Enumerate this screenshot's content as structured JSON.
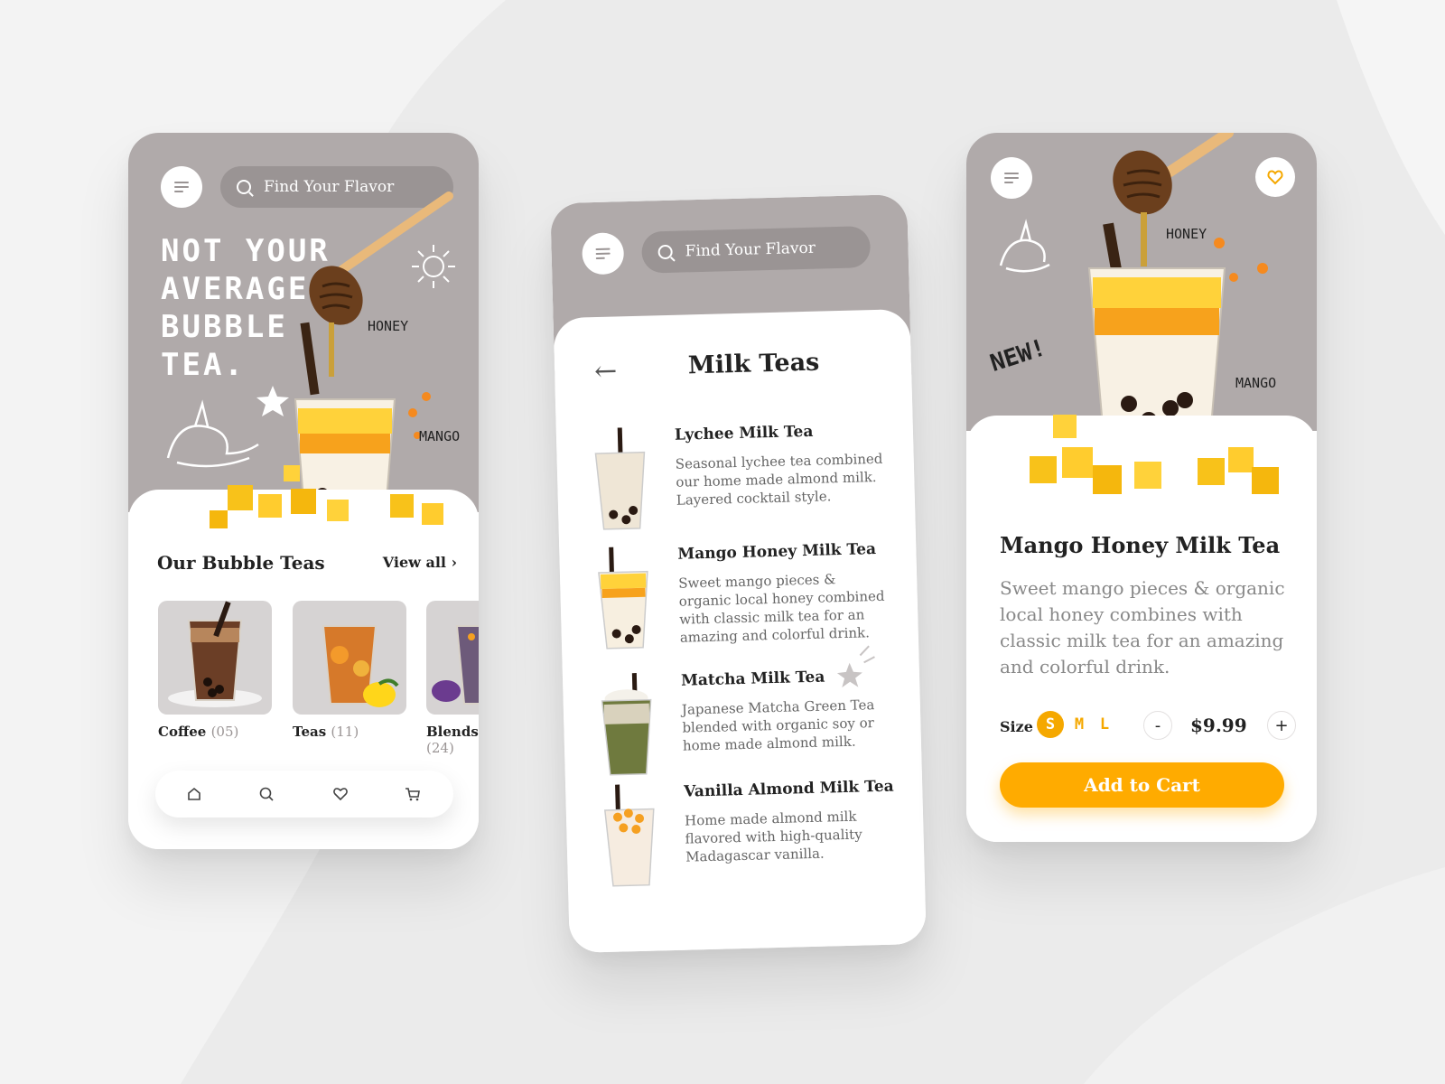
{
  "colors": {
    "accent": "#ffab00",
    "header_grey": "#b0aaaa",
    "search_grey": "#9a9494"
  },
  "home": {
    "search_placeholder": "Find Your Flavor",
    "headline": "NOT YOUR\nAVERAGE\nBUBBLE\nTEA.",
    "label_honey": "HONEY",
    "label_mango": "MANGO",
    "section_title": "Our Bubble Teas",
    "view_all": "View all",
    "categories": [
      {
        "name": "Coffee",
        "count": "(05)"
      },
      {
        "name": "Teas",
        "count": "(11)"
      },
      {
        "name": "Blends",
        "count": "(24)"
      }
    ],
    "nav": [
      "home-icon",
      "search-icon",
      "heart-icon",
      "cart-icon"
    ]
  },
  "list": {
    "search_placeholder": "Find Your Flavor",
    "back": "←",
    "title": "Milk Teas",
    "items": [
      {
        "name": "Lychee Milk Tea",
        "desc": "Seasonal lychee tea combined our home made almond milk. Layered cocktail style."
      },
      {
        "name": "Mango Honey Milk Tea",
        "desc": "Sweet mango pieces & organic local honey combined with classic milk tea for an amazing and colorful drink."
      },
      {
        "name": "Matcha Milk Tea",
        "desc": "Japanese Matcha Green Tea blended with organic soy or home made almond milk."
      },
      {
        "name": "Vanilla Almond Milk Tea",
        "desc": "Home made almond milk flavored with high-quality Madagascar vanilla."
      }
    ]
  },
  "detail": {
    "label_honey": "HONEY",
    "label_mango": "MANGO",
    "label_new": "NEW!",
    "name": "Mango Honey Milk Tea",
    "desc": "Sweet mango pieces & organic local honey combines with classic milk tea for an amazing and colorful drink.",
    "size_label": "Size",
    "sizes": [
      "S",
      "M",
      "L"
    ],
    "selected_size": "S",
    "minus": "-",
    "plus": "+",
    "price": "$9.99",
    "add_to_cart": "Add to Cart"
  }
}
